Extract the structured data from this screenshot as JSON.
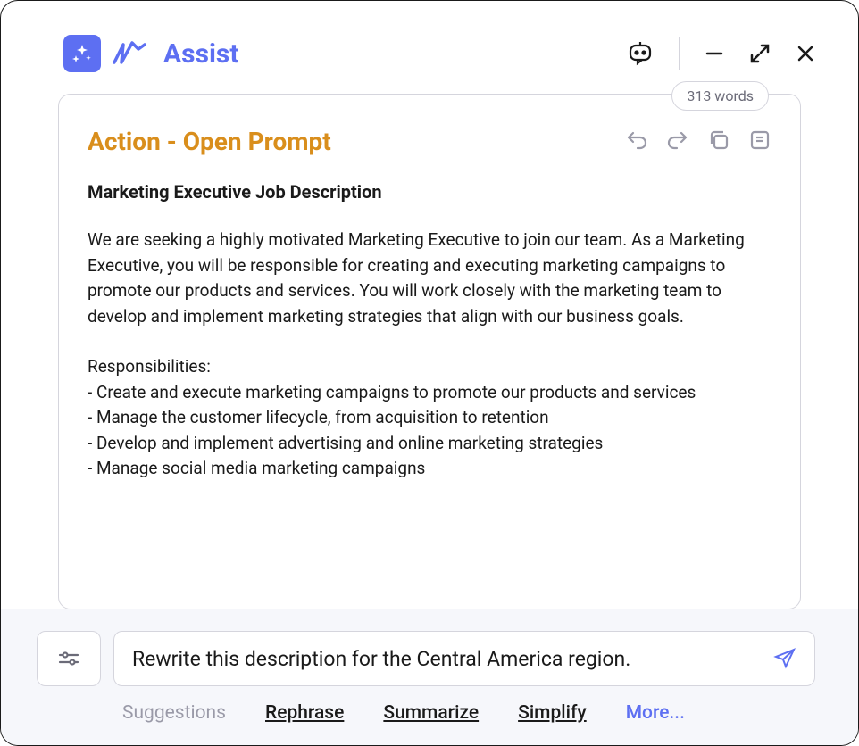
{
  "header": {
    "brand": "Assist"
  },
  "wordCount": "313 words",
  "card": {
    "title": "Action - Open Prompt",
    "contentTitle": "Marketing Executive Job Description",
    "paragraph": "We are seeking a highly motivated Marketing Executive to join our team. As a Marketing Executive, you will be responsible for creating and executing marketing campaigns to promote our products and services. You will work closely with the marketing team to develop and implement marketing strategies that align with our business goals.",
    "respLabel": "Responsibilities:",
    "responsibilities": [
      "- Create and execute marketing campaigns to promote our products and services",
      "- Manage the customer lifecycle, from acquisition to retention",
      "- Develop and implement advertising and online marketing strategies",
      "- Manage social media marketing campaigns"
    ]
  },
  "input": {
    "value": "Rewrite this description for the Central America region."
  },
  "suggestions": {
    "label": "Suggestions",
    "items": [
      "Rephrase",
      "Summarize",
      "Simplify"
    ],
    "more": "More..."
  }
}
